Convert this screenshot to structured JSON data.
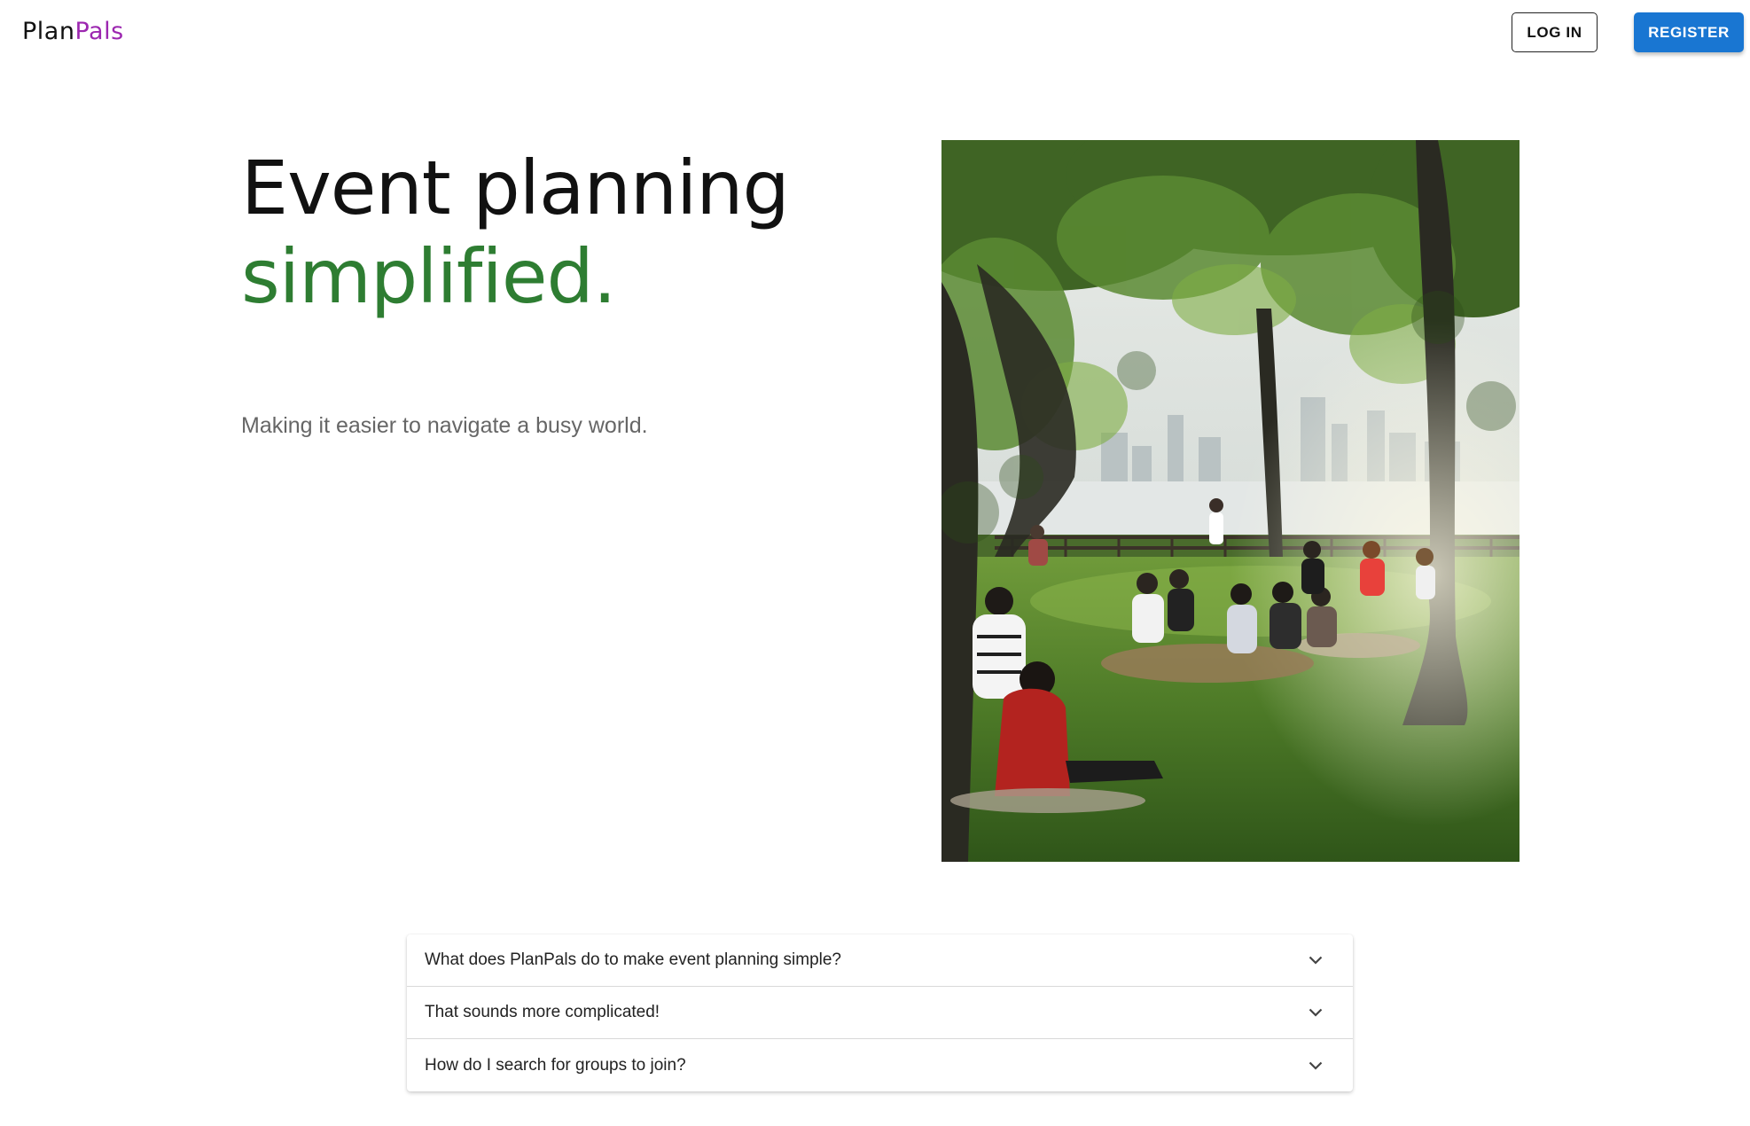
{
  "header": {
    "logo_part1": "Plan",
    "logo_part2": "Pals",
    "login_label": "LOG IN",
    "register_label": "REGISTER"
  },
  "hero": {
    "title_line1": "Event planning",
    "title_line2": "simplified.",
    "subtitle": "Making it easier to navigate a busy world."
  },
  "faq": {
    "items": [
      {
        "question": "What does PlanPals do to make event planning simple?"
      },
      {
        "question": "That sounds more complicated!"
      },
      {
        "question": "How do I search for groups to join?"
      }
    ]
  },
  "colors": {
    "accent_purple": "#9c27b0",
    "accent_green": "#2e7d32",
    "primary_blue": "#1976d2"
  }
}
